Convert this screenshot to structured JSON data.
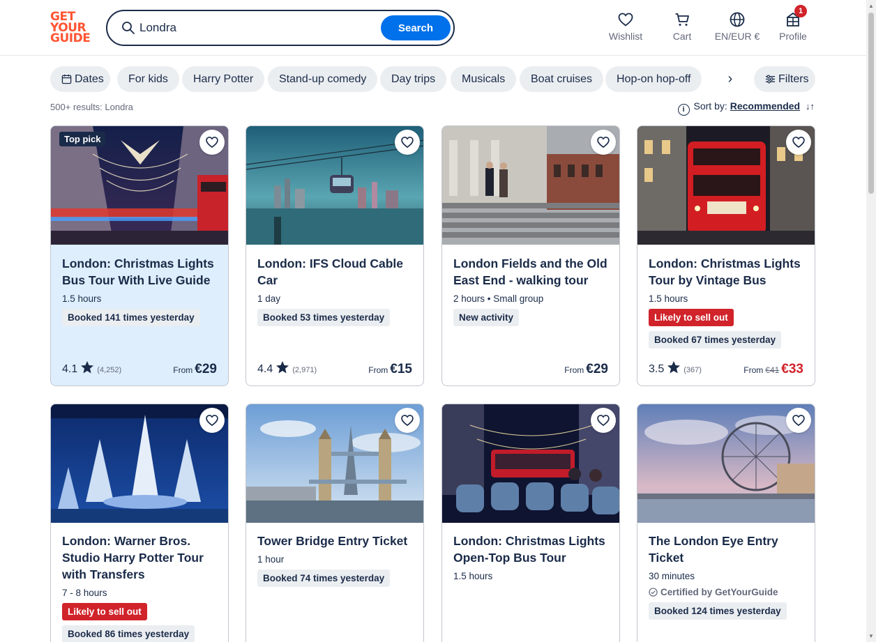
{
  "logo": {
    "lines": [
      "GET",
      "YOUR",
      "GUIDE"
    ]
  },
  "search": {
    "value": "Londra",
    "button_label": "Search"
  },
  "header": {
    "wishlist": "Wishlist",
    "cart": "Cart",
    "language": "EN/EUR €",
    "profile": "Profile",
    "profile_badge": "1"
  },
  "filters": {
    "chips": [
      "Dates",
      "For kids",
      "Harry Potter",
      "Stand-up comedy",
      "Day trips",
      "Musicals",
      "Boat cruises",
      "Hop-on hop-off"
    ],
    "filters_label": "Filters"
  },
  "results": {
    "count": "500+ results: Londra",
    "sort_label": "Sort by:",
    "sort_value": "Recommended"
  },
  "cards": [
    {
      "badge": "Top pick",
      "title": "London: Christmas Lights Bus Tour With Live Guide",
      "meta": "1.5 hours",
      "pills": [
        "Booked 141 times yesterday"
      ],
      "rating": "4.1",
      "reviews": "(4,252)",
      "from": "From",
      "price": "€29"
    },
    {
      "title": "London: IFS Cloud Cable Car",
      "meta": "1 day",
      "pills": [
        "Booked 53 times yesterday"
      ],
      "rating": "4.4",
      "reviews": "(2,971)",
      "from": "From",
      "price": "€15"
    },
    {
      "title": "London Fields and the Old East End - walking tour",
      "meta": "2 hours • Small group",
      "pills": [
        "New activity"
      ],
      "from": "From",
      "price": "€29"
    },
    {
      "title": "London: Christmas Lights Tour by Vintage Bus",
      "meta": "1.5 hours",
      "red_pill": "Likely to sell out",
      "pills": [
        "Booked 67 times yesterday"
      ],
      "rating": "3.5",
      "reviews": "(367)",
      "from": "From",
      "old_price": "€41",
      "price": "€33"
    },
    {
      "title": "London: Warner Bros. Studio Harry Potter Tour with Transfers",
      "meta": "7 - 8 hours",
      "red_pill": "Likely to sell out",
      "pills": [
        "Booked 86 times yesterday"
      ]
    },
    {
      "title": "Tower Bridge Entry Ticket",
      "meta": "1 hour",
      "pills": [
        "Booked 74 times yesterday"
      ]
    },
    {
      "title": "London: Christmas Lights Open-Top Bus Tour",
      "meta": "1.5 hours"
    },
    {
      "title": "The London Eye Entry Ticket",
      "meta": "30 minutes",
      "certified": "Certified by GetYourGuide",
      "pills": [
        "Booked 124 times yesterday"
      ]
    }
  ],
  "colors": {
    "brand": "#ff5533",
    "accent": "#0071eb",
    "navy": "#1a2b49",
    "sale": "#d1232a",
    "highlight": "#deeefc"
  }
}
